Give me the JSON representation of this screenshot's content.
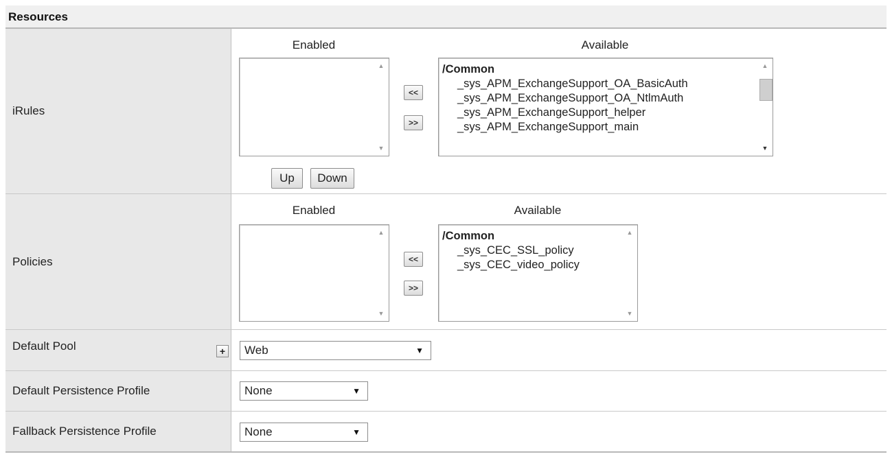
{
  "section": {
    "title": "Resources"
  },
  "irules": {
    "label": "iRules",
    "enabled_heading": "Enabled",
    "available_heading": "Available",
    "available_group": "/Common",
    "available_items": [
      "_sys_APM_ExchangeSupport_OA_BasicAuth",
      "_sys_APM_ExchangeSupport_OA_NtlmAuth",
      "_sys_APM_ExchangeSupport_helper",
      "_sys_APM_ExchangeSupport_main"
    ],
    "move_left_label": "<<",
    "move_right_label": ">>",
    "up_label": "Up",
    "down_label": "Down"
  },
  "policies": {
    "label": "Policies",
    "enabled_heading": "Enabled",
    "available_heading": "Available",
    "available_group": "/Common",
    "available_items": [
      "_sys_CEC_SSL_policy",
      "_sys_CEC_video_policy"
    ],
    "move_left_label": "<<",
    "move_right_label": ">>"
  },
  "default_pool": {
    "label": "Default Pool",
    "add_label": "+",
    "value": "Web"
  },
  "default_persistence": {
    "label": "Default Persistence Profile",
    "value": "None"
  },
  "fallback_persistence": {
    "label": "Fallback Persistence Profile",
    "value": "None"
  },
  "icons": {
    "dropdown": "triangle-down-icon",
    "scroll_up": "triangle-up-icon",
    "scroll_down": "triangle-down-icon"
  }
}
